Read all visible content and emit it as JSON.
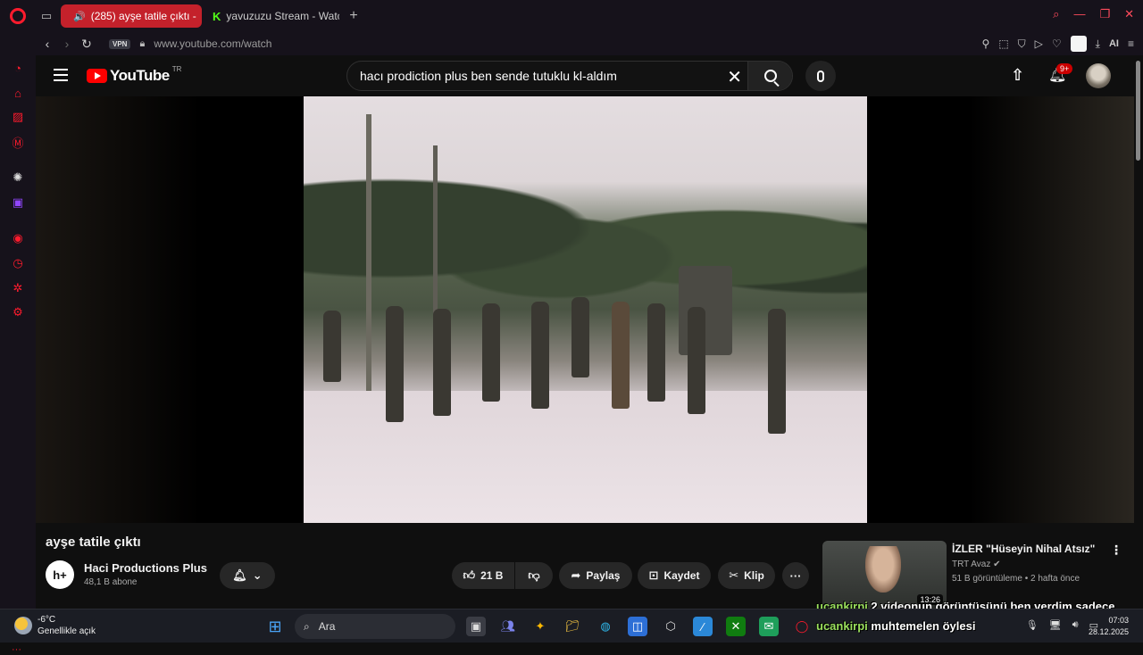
{
  "browser": {
    "tabs": [
      {
        "label": "(285) ayşe tatile çıktı -",
        "active": true
      },
      {
        "label": "yavuzuzu Stream - Watch",
        "active": false
      }
    ],
    "vpn_label": "VPN",
    "url": "www.youtube.com/watch",
    "ai_label": "AI",
    "sidebar_gx": "GX"
  },
  "youtube": {
    "logo_text": "YouTube",
    "country_code": "TR",
    "search_value": "hacı prodiction plus ben sende tutuklu kl-aldım",
    "notification_badge": "9+"
  },
  "video": {
    "title": "ayşe tatile çıktı",
    "channel_name": "Haci Productions Plus",
    "subscribers": "48,1 B abone",
    "channel_avatar_text": "h+",
    "like_count": "21 B",
    "share_label": "Paylaş",
    "save_label": "Kaydet",
    "clip_label": "Klip"
  },
  "recommendation": {
    "title": "İZLER \"Hüseyin Nihal Atsız\"",
    "channel": "TRT Avaz",
    "meta": "51 B görüntüleme • 2 hafta önce",
    "duration": "13:26"
  },
  "chat_overlay": [
    {
      "user": "ucankirpi",
      "message": "2 videonun görüntüsünü ben verdim sadece"
    },
    {
      "user": "ucankirpi",
      "message": "muhtemelen öylesi"
    }
  ],
  "taskbar": {
    "temperature": "-6°C",
    "weather_desc": "Genellikle açık",
    "weather_badge": "6",
    "search_placeholder": "Ara",
    "time": "07:03",
    "date": "28.12.2025"
  },
  "colors": {
    "opera_red": "#ff1b2d",
    "active_tab": "#c4212b",
    "youtube_red": "#ff0000",
    "chat_username": "#9be15d"
  }
}
